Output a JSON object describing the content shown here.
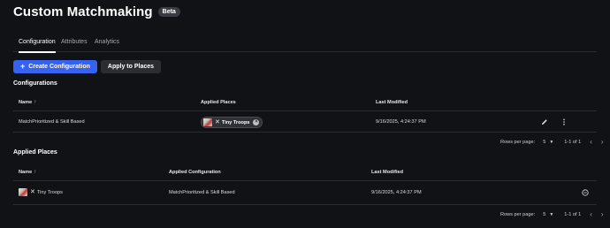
{
  "header": {
    "title": "Custom Matchmaking",
    "badge": "Beta"
  },
  "tabs": [
    {
      "label": "Configuration",
      "active": true
    },
    {
      "label": "Attributes",
      "active": false
    },
    {
      "label": "Analytics",
      "active": false
    }
  ],
  "actions": {
    "create_label": "Create Configuration",
    "create_icon": "+",
    "apply_label": "Apply to Places"
  },
  "configurations": {
    "title": "Configurations",
    "columns": {
      "name": "Name",
      "applied_places": "Applied Places",
      "last_modified": "Last Modified"
    },
    "rows": [
      {
        "name": "MatchPrioritized & Skill Based",
        "applied_place": "Tiny Troops",
        "last_modified": "9/16/2025, 4:24:37 PM"
      }
    ],
    "pagination": {
      "rows_per_page_label": "Rows per page:",
      "rows_per_page": "5",
      "range": "1-1 of 1"
    }
  },
  "applied_places": {
    "title": "Applied Places",
    "columns": {
      "name": "Name",
      "applied_configuration": "Applied Configuration",
      "last_modified": "Last Modified"
    },
    "rows": [
      {
        "name": "Tiny Troops",
        "applied_configuration": "MatchPrioritized & Skill Based",
        "last_modified": "9/16/2025, 4:24:37 PM"
      }
    ],
    "pagination": {
      "rows_per_page_label": "Rows per page:",
      "rows_per_page": "5",
      "range": "1-1 of 1"
    }
  },
  "icons": {
    "sort": "arrow-up-icon",
    "edit": "pencil-icon",
    "more": "kebab-icon",
    "remove": "minus-circle-icon",
    "chip_close": "close-circle-icon",
    "prev": "chevron-left-icon",
    "next": "chevron-right-icon"
  },
  "colors": {
    "background": "#111216",
    "accent": "#3761f0",
    "border": "#2a2c31"
  }
}
